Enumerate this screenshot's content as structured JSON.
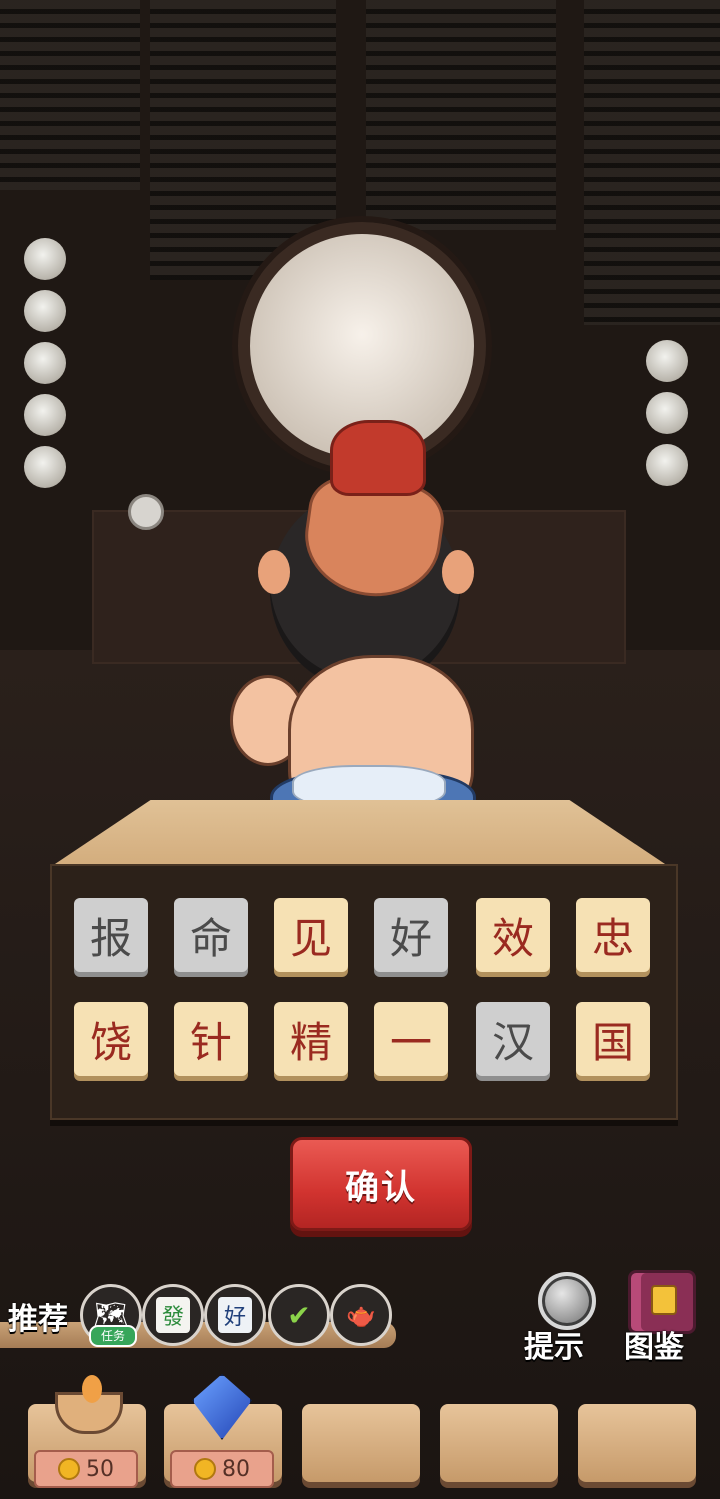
{
  "board": {
    "tiles": [
      {
        "char": "报",
        "state": "off"
      },
      {
        "char": "命",
        "state": "off"
      },
      {
        "char": "见",
        "state": "on"
      },
      {
        "char": "好",
        "state": "off"
      },
      {
        "char": "效",
        "state": "on"
      },
      {
        "char": "忠",
        "state": "on"
      },
      {
        "char": "饶",
        "state": "on"
      },
      {
        "char": "针",
        "state": "on"
      },
      {
        "char": "精",
        "state": "on"
      },
      {
        "char": "一",
        "state": "on"
      },
      {
        "char": "汉",
        "state": "off"
      },
      {
        "char": "国",
        "state": "on"
      }
    ],
    "confirm_label": "确认"
  },
  "recommend": {
    "label": "推荐",
    "items": [
      {
        "icon": "task-map-icon",
        "badge": "任务"
      },
      {
        "icon": "mahjong-fa-tile-icon",
        "glyph": "發"
      },
      {
        "icon": "mahjong-hao-tile-icon",
        "glyph": "好"
      },
      {
        "icon": "blue-crystal-check-icon"
      },
      {
        "icon": "teapot-icon"
      }
    ]
  },
  "tools": {
    "hint_label": "提示",
    "atlas_label": "图鉴"
  },
  "inventory": {
    "slots": [
      {
        "item": "incense-bowl-icon",
        "price": "50"
      },
      {
        "item": "blue-gem-icon",
        "price": "80"
      },
      {
        "item": null
      },
      {
        "item": null
      },
      {
        "item": null
      }
    ]
  }
}
